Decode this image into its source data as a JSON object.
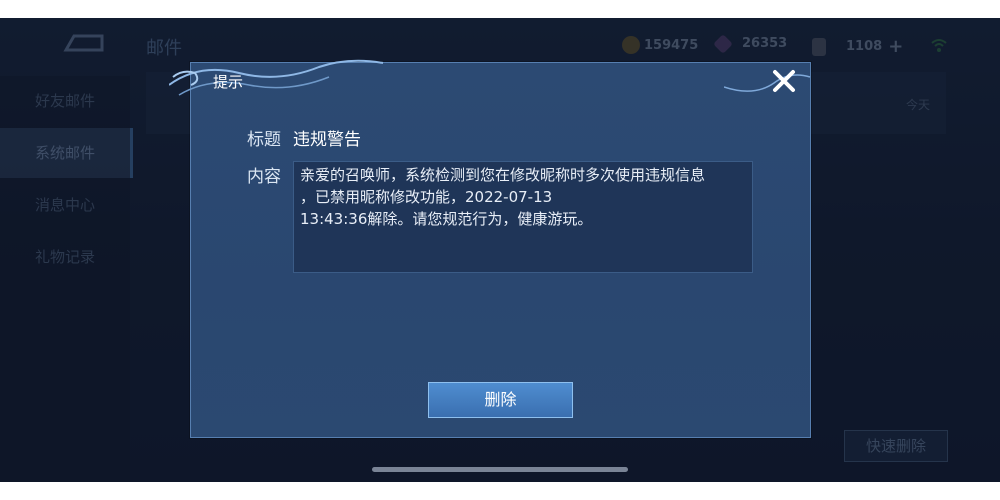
{
  "header": {
    "title": "邮件",
    "currencies": [
      {
        "icon": "gold-coin-icon",
        "value": "159475"
      },
      {
        "icon": "diamond-icon",
        "value": "26353"
      },
      {
        "icon": "voucher-icon",
        "value": "1108"
      }
    ]
  },
  "sidebar": {
    "items": [
      {
        "label": "好友邮件"
      },
      {
        "label": "系统邮件"
      },
      {
        "label": "消息中心"
      },
      {
        "label": "礼物记录"
      }
    ]
  },
  "mail_list": {
    "date": "今天"
  },
  "footer": {
    "quick_delete_label": "快速删除"
  },
  "dialog": {
    "title": "提示",
    "subject_label": "标题",
    "subject_value": "违规警告",
    "content_label": "内容",
    "content_lines": [
      "亲爱的召唤师，系统检测到您在修改昵称时多次使用违规信息",
      "，已禁用昵称修改功能，2022-07-13",
      "13:43:36解除。请您规范行为，健康游玩。"
    ],
    "delete_label": "删除"
  },
  "colors": {
    "dialog_bg": "#2c4a73",
    "button_blue": "#4f8dd0",
    "accent_border": "#577fb0"
  }
}
